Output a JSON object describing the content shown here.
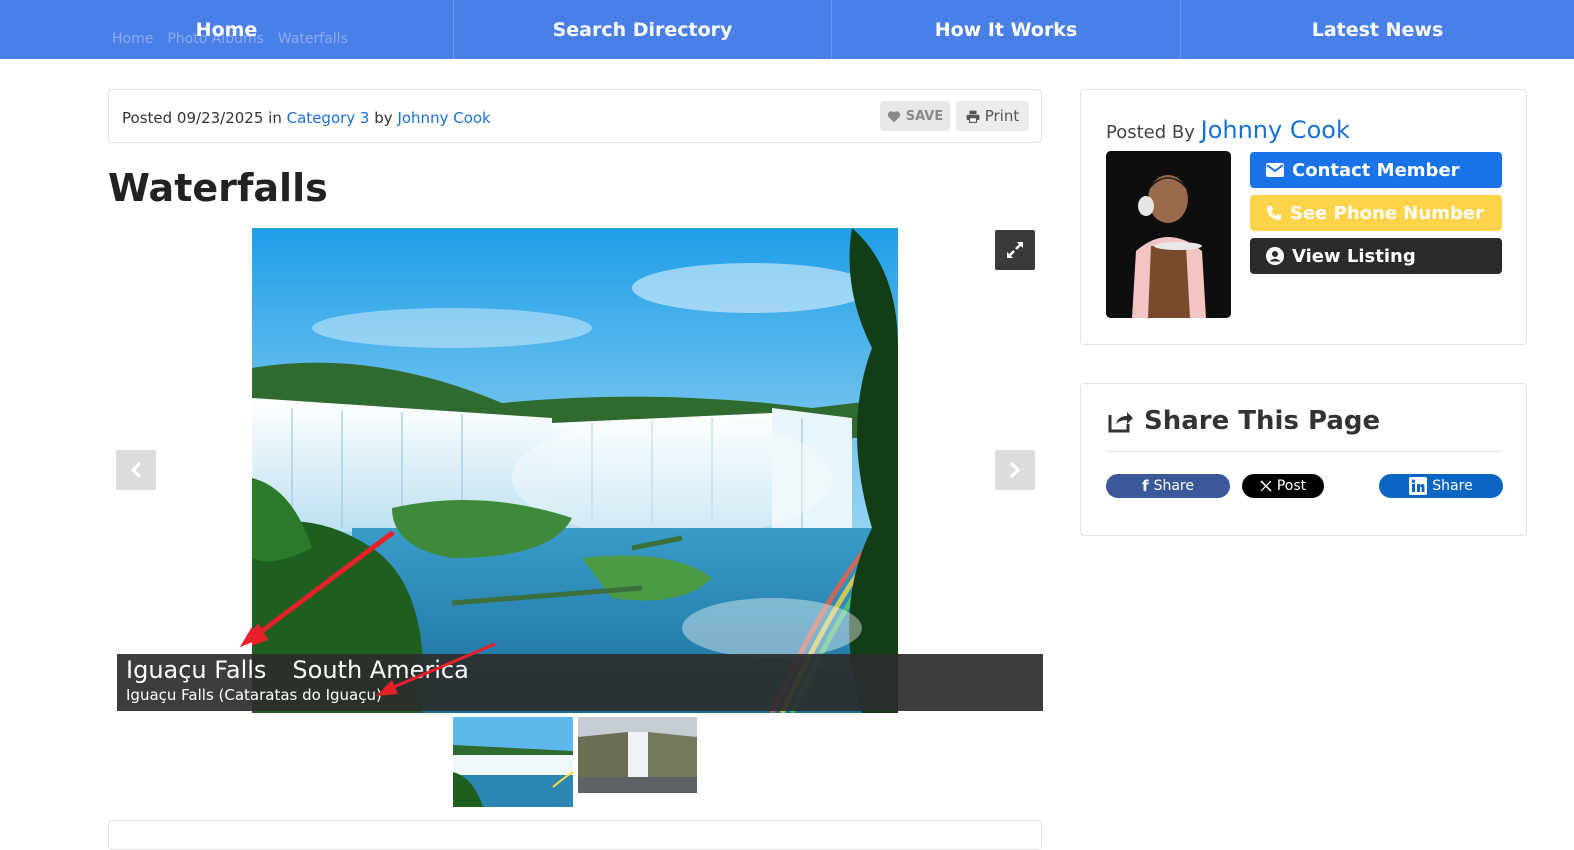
{
  "nav": {
    "items": [
      {
        "label": "Home"
      },
      {
        "label": "Search Directory"
      },
      {
        "label": "How It Works"
      },
      {
        "label": "Latest News"
      }
    ]
  },
  "breadcrumb": [
    "Home",
    "Photo Albums",
    "Waterfalls"
  ],
  "post": {
    "posted_prefix": "Posted",
    "date": "09/23/2025",
    "in_text": "in",
    "category": "Category 3",
    "by_text": "by",
    "author": "Johnny Cook",
    "save_label": "SAVE",
    "print_label": "Print",
    "title": "Waterfalls"
  },
  "gallery": {
    "caption_title": "Iguaçu Falls",
    "caption_location": "South America",
    "caption_subtitle": "Iguaçu Falls (Cataratas do Iguaçu)"
  },
  "sidebar": {
    "posted_by_label": "Posted By",
    "author": "Johnny Cook",
    "contact_label": "Contact Member",
    "phone_label": "See Phone Number",
    "view_label": "View Listing",
    "share_title": "Share This Page",
    "facebook_label": "Share",
    "x_label": "Post",
    "linkedin_label": "Share"
  },
  "colors": {
    "nav_bg": "#4a7fe8",
    "link": "#1a6fd6",
    "contact_btn": "#1a73e8",
    "phone_btn": "#fdd34a",
    "view_btn": "#2b2b2b",
    "facebook": "#3b5998",
    "x": "#000000",
    "linkedin": "#0a66c2",
    "annotation_arrow": "#e8202a"
  }
}
